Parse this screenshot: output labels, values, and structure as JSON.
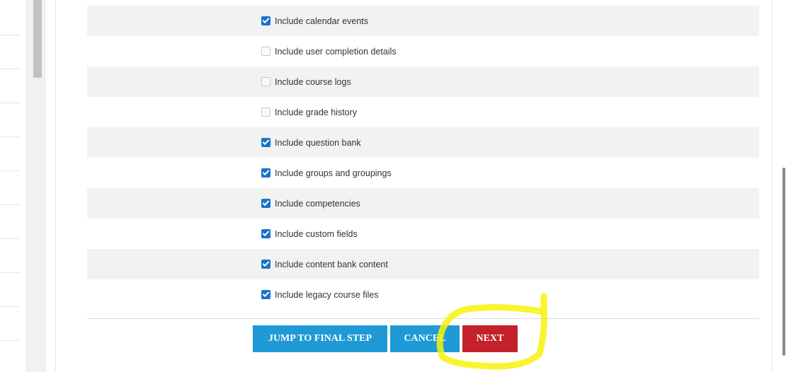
{
  "options": [
    {
      "label": "Include calendar events",
      "checked": true
    },
    {
      "label": "Include user completion details",
      "checked": false
    },
    {
      "label": "Include course logs",
      "checked": false
    },
    {
      "label": "Include grade history",
      "checked": false
    },
    {
      "label": "Include question bank",
      "checked": true
    },
    {
      "label": "Include groups and groupings",
      "checked": true
    },
    {
      "label": "Include competencies",
      "checked": true
    },
    {
      "label": "Include custom fields",
      "checked": true
    },
    {
      "label": "Include content bank content",
      "checked": true
    },
    {
      "label": "Include legacy course files",
      "checked": true
    }
  ],
  "buttons": {
    "jump_label": "JUMP TO FINAL STEP",
    "cancel_label": "CANCEL",
    "next_label": "NEXT"
  },
  "colors": {
    "primary_button": "#1f9ad6",
    "next_button": "#c4212b",
    "checkbox_checked": "#1a73c9",
    "highlight_annotation": "#f7f30a"
  }
}
